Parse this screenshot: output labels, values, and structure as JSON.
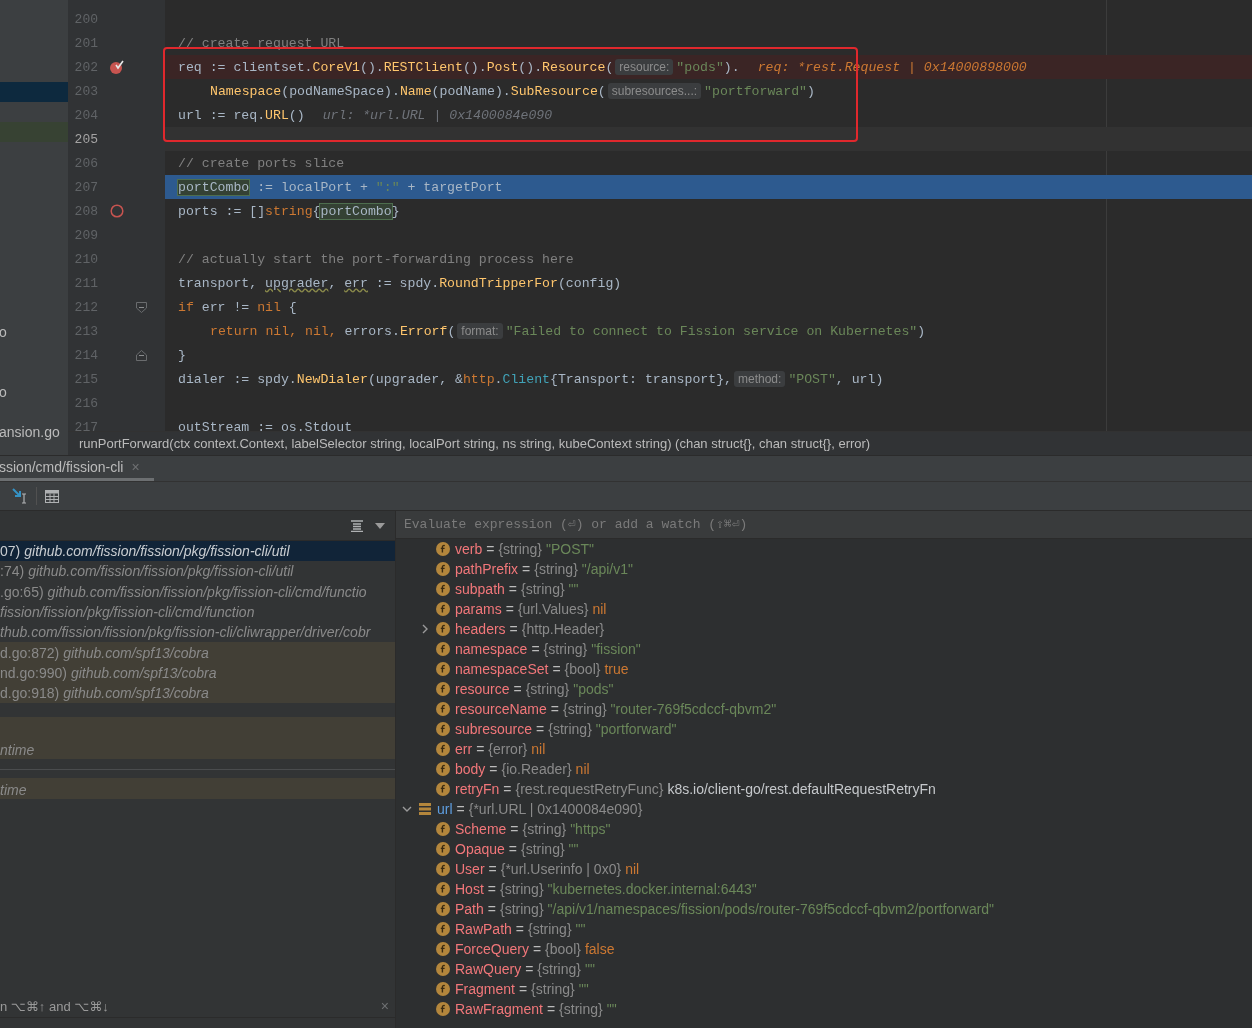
{
  "sidebar": {
    "rows": [
      {
        "kind": "blank"
      },
      {
        "kind": "blank"
      },
      {
        "kind": "blank"
      },
      {
        "kind": "blank"
      },
      {
        "kind": "selected"
      },
      {
        "kind": "blank"
      },
      {
        "kind": "modified"
      },
      {
        "kind": "blank"
      },
      {
        "kind": "blank"
      },
      {
        "kind": "blank"
      },
      {
        "kind": "blank"
      },
      {
        "kind": "blank"
      },
      {
        "kind": "blank"
      },
      {
        "kind": "blank"
      },
      {
        "kind": "blank"
      },
      {
        "kind": "blank"
      },
      {
        "kind": "file",
        "label": "o"
      },
      {
        "kind": "blank"
      },
      {
        "kind": "blank"
      },
      {
        "kind": "file",
        "label": "o"
      },
      {
        "kind": "blank"
      },
      {
        "kind": "file",
        "label": "ansion.go"
      }
    ]
  },
  "editor": {
    "lines": [
      {
        "number": "200",
        "kind": "plain"
      },
      {
        "number": "201",
        "kind": "plain",
        "indented": false,
        "tokens": [
          {
            "kind": "cmt",
            "text": "// create request URL"
          }
        ]
      },
      {
        "number": "202",
        "kind": "suspended",
        "indented": false,
        "tokens": [
          {
            "kind": "p",
            "text": "req := clientset."
          },
          {
            "kind": "fn",
            "text": "CoreV1"
          },
          {
            "kind": "p",
            "text": "()."
          },
          {
            "kind": "fn",
            "text": "RESTClient"
          },
          {
            "kind": "p",
            "text": "()."
          },
          {
            "kind": "fn",
            "text": "Post"
          },
          {
            "kind": "p",
            "text": "()."
          },
          {
            "kind": "fn",
            "text": "Resource"
          },
          {
            "kind": "p",
            "text": "("
          },
          {
            "kind": "hint",
            "text": "resource:"
          },
          {
            "kind": "str",
            "text": "\"pods\""
          },
          {
            "kind": "p",
            "text": ")."
          },
          {
            "kind": "dbg_hit",
            "text": "req: *rest.Request | 0x14000898000"
          }
        ]
      },
      {
        "number": "203",
        "kind": "plain",
        "indented": true,
        "tokens": [
          {
            "kind": "fn",
            "text": "Namespace"
          },
          {
            "kind": "p",
            "text": "(podNameSpace)."
          },
          {
            "kind": "fn",
            "text": "Name"
          },
          {
            "kind": "p",
            "text": "(podName)."
          },
          {
            "kind": "fn",
            "text": "SubResource"
          },
          {
            "kind": "p",
            "text": "("
          },
          {
            "kind": "hint",
            "text": "subresources...:"
          },
          {
            "kind": "str",
            "text": "\"portforward\""
          },
          {
            "kind": "p",
            "text": ")"
          }
        ]
      },
      {
        "number": "204",
        "kind": "plain",
        "indented": false,
        "tokens": [
          {
            "kind": "p",
            "text": "url := req."
          },
          {
            "kind": "fn",
            "text": "URL"
          },
          {
            "kind": "p",
            "text": "()"
          },
          {
            "kind": "dbg",
            "text": "url: *url.URL | 0x1400084e090"
          }
        ]
      },
      {
        "number": "205",
        "kind": "current"
      },
      {
        "number": "206",
        "kind": "plain",
        "indented": false,
        "tokens": [
          {
            "kind": "cmt",
            "text": "// create ports slice"
          }
        ]
      },
      {
        "number": "207",
        "kind": "selected",
        "indented": false,
        "tokens": [
          {
            "kind": "usage",
            "text": "portCombo"
          },
          {
            "kind": "p",
            "text": " := localPort + "
          },
          {
            "kind": "str",
            "text": "\":\""
          },
          {
            "kind": "p",
            "text": " + targetPort"
          }
        ]
      },
      {
        "number": "208",
        "kind": "breakpoint",
        "indented": false,
        "tokens": [
          {
            "kind": "p",
            "text": "ports := []"
          },
          {
            "kind": "kw",
            "text": "string"
          },
          {
            "kind": "p",
            "text": "{"
          },
          {
            "kind": "usage",
            "text": "portCombo"
          },
          {
            "kind": "p",
            "text": "}"
          }
        ]
      },
      {
        "number": "209",
        "kind": "plain"
      },
      {
        "number": "210",
        "kind": "plain",
        "indented": false,
        "tokens": [
          {
            "kind": "cmt",
            "text": "// actually start the port-forwarding process here"
          }
        ]
      },
      {
        "number": "211",
        "kind": "plain",
        "indented": false,
        "tokens": [
          {
            "kind": "p",
            "text": "transport, "
          },
          {
            "kind": "warn",
            "text": "upgrader"
          },
          {
            "kind": "p",
            "text": ", "
          },
          {
            "kind": "warn",
            "text": "err"
          },
          {
            "kind": "p",
            "text": " := spdy."
          },
          {
            "kind": "fn",
            "text": "RoundTripperFor"
          },
          {
            "kind": "p",
            "text": "(config)"
          }
        ]
      },
      {
        "number": "212",
        "kind": "fold_start",
        "indented": false,
        "tokens": [
          {
            "kind": "kw",
            "text": "if"
          },
          {
            "kind": "p",
            "text": " err != "
          },
          {
            "kind": "kw",
            "text": "nil"
          },
          {
            "kind": "p",
            "text": " {"
          }
        ]
      },
      {
        "number": "213",
        "kind": "plain",
        "indented": true,
        "tokens": [
          {
            "kind": "kw",
            "text": "return nil, nil,"
          },
          {
            "kind": "p",
            "text": " errors."
          },
          {
            "kind": "fn",
            "text": "Errorf"
          },
          {
            "kind": "p",
            "text": "("
          },
          {
            "kind": "hint",
            "text": "format:"
          },
          {
            "kind": "str",
            "text": "\"Failed to connect to Fission service on Kubernetes\""
          },
          {
            "kind": "p",
            "text": ")"
          }
        ]
      },
      {
        "number": "214",
        "kind": "fold_end",
        "indented": false,
        "tokens": [
          {
            "kind": "p",
            "text": "}"
          }
        ]
      },
      {
        "number": "215",
        "kind": "plain",
        "indented": false,
        "tokens": [
          {
            "kind": "p",
            "text": "dialer := spdy."
          },
          {
            "kind": "fn",
            "text": "NewDialer"
          },
          {
            "kind": "p",
            "text": "(upgrader, &"
          },
          {
            "kind": "kw",
            "text": "http"
          },
          {
            "kind": "p",
            "text": "."
          },
          {
            "kind": "type",
            "text": "Client"
          },
          {
            "kind": "p",
            "text": "{Transport: transport},"
          },
          {
            "kind": "hint",
            "text": "method:"
          },
          {
            "kind": "str",
            "text": "\"POST\""
          },
          {
            "kind": "p",
            "text": ", url)"
          }
        ]
      },
      {
        "number": "216",
        "kind": "plain"
      },
      {
        "number": "217",
        "kind": "plain",
        "indented": false,
        "tokens": [
          {
            "kind": "p",
            "text": "outStream := os.Stdout"
          }
        ]
      }
    ],
    "breadcrumb": "runPortForward(ctx context.Context, labelSelector string, localPort string, ns string, kubeContext string) (chan struct{}, chan struct{}, error)"
  },
  "debug_tab": {
    "label": "ssion/cmd/fission-cli",
    "close": "×"
  },
  "frames": [
    {
      "lead": "07)",
      "package": "github.com/fission/fission/pkg/fission-cli/util",
      "selected": true,
      "library": false
    },
    {
      "lead": ":74)",
      "package": "github.com/fission/fission/pkg/fission-cli/util",
      "selected": false,
      "library": false
    },
    {
      "lead": ".go:65)",
      "package": "github.com/fission/fission/pkg/fission-cli/cmd/functio",
      "selected": false,
      "library": false
    },
    {
      "package": "fission/fission/pkg/fission-cli/cmd/function",
      "selected": false,
      "library": false
    },
    {
      "package": "thub.com/fission/fission/pkg/fission-cli/cliwrapper/driver/cobr",
      "selected": false,
      "library": false
    },
    {
      "lead": "d.go:872)",
      "package": "github.com/spf13/cobra",
      "selected": false,
      "library": true
    },
    {
      "lead": "nd.go:990)",
      "package": "github.com/spf13/cobra",
      "selected": false,
      "library": true
    },
    {
      "lead": "d.go:918)",
      "package": "github.com/spf13/cobra",
      "selected": false,
      "library": true
    }
  ],
  "threads": [
    {
      "label": "ntime"
    },
    {
      "label": "time"
    }
  ],
  "frames_hint": {
    "text": "n ⌥⌘↑ and ⌥⌘↓",
    "close": "×"
  },
  "watch": {
    "placeholder": "Evaluate expression (⏎) or add a watch (⇧⌘⏎)"
  },
  "variables": [
    {
      "kind": "continuation",
      "children": [
        {
          "kind": "field",
          "name": "verb",
          "op": "=",
          "type": "{string}",
          "value": {
            "kind": "str",
            "text": "\"POST\""
          }
        },
        {
          "kind": "field",
          "name": "pathPrefix",
          "op": "=",
          "type": "{string}",
          "value": {
            "kind": "str",
            "text": "\"/api/v1\""
          }
        },
        {
          "kind": "field",
          "name": "subpath",
          "op": "=",
          "type": "{string}",
          "value": {
            "kind": "str",
            "text": "\"\""
          }
        },
        {
          "kind": "field",
          "name": "params",
          "op": "=",
          "type": "{url.Values}",
          "value": {
            "kind": "kw",
            "text": "nil"
          }
        },
        {
          "kind": "field",
          "name": "headers",
          "op": "=",
          "type": "{http.Header}",
          "expanded": false
        },
        {
          "kind": "field",
          "name": "namespace",
          "op": "=",
          "type": "{string}",
          "value": {
            "kind": "str",
            "text": "\"fission\""
          }
        },
        {
          "kind": "field",
          "name": "namespaceSet",
          "op": "=",
          "type": "{bool}",
          "value": {
            "kind": "kw",
            "text": "true"
          }
        },
        {
          "kind": "field",
          "name": "resource",
          "op": "=",
          "type": "{string}",
          "value": {
            "kind": "str",
            "text": "\"pods\""
          }
        },
        {
          "kind": "field",
          "name": "resourceName",
          "op": "=",
          "type": "{string}",
          "value": {
            "kind": "str",
            "text": "\"router-769f5cdccf-qbvm2\""
          }
        },
        {
          "kind": "field",
          "name": "subresource",
          "op": "=",
          "type": "{string}",
          "value": {
            "kind": "str",
            "text": "\"portforward\""
          }
        },
        {
          "kind": "field",
          "name": "err",
          "op": "=",
          "type": "{error}",
          "value": {
            "kind": "kw",
            "text": "nil"
          }
        },
        {
          "kind": "field",
          "name": "body",
          "op": "=",
          "type": "{io.Reader}",
          "value": {
            "kind": "kw",
            "text": "nil"
          }
        },
        {
          "kind": "field",
          "name": "retryFn",
          "op": "=",
          "type": "{rest.requestRetryFunc}",
          "value": {
            "kind": "plain",
            "text": "k8s.io/client-go/rest.defaultRequestRetryFn"
          }
        }
      ]
    },
    {
      "kind": "struct",
      "name": "url",
      "op": "=",
      "type": "{*url.URL | 0x1400084e090}",
      "expanded": true,
      "children": [
        {
          "kind": "field",
          "name": "Scheme",
          "op": "=",
          "type": "{string}",
          "value": {
            "kind": "str",
            "text": "\"https\""
          }
        },
        {
          "kind": "field",
          "name": "Opaque",
          "op": "=",
          "type": "{string}",
          "value": {
            "kind": "str",
            "text": "\"\""
          }
        },
        {
          "kind": "field",
          "name": "User",
          "op": "=",
          "type": "{*url.Userinfo | 0x0}",
          "value": {
            "kind": "kw",
            "text": "nil"
          }
        },
        {
          "kind": "field",
          "name": "Host",
          "op": "=",
          "type": "{string}",
          "value": {
            "kind": "str",
            "text": "\"kubernetes.docker.internal:6443\""
          }
        },
        {
          "kind": "field",
          "name": "Path",
          "op": "=",
          "type": "{string}",
          "value": {
            "kind": "str",
            "text": "\"/api/v1/namespaces/fission/pods/router-769f5cdccf-qbvm2/portforward\""
          }
        },
        {
          "kind": "field",
          "name": "RawPath",
          "op": "=",
          "type": "{string}",
          "value": {
            "kind": "str",
            "text": "\"\""
          }
        },
        {
          "kind": "field",
          "name": "ForceQuery",
          "op": "=",
          "type": "{bool}",
          "value": {
            "kind": "kw",
            "text": "false"
          }
        },
        {
          "kind": "field",
          "name": "RawQuery",
          "op": "=",
          "type": "{string}",
          "value": {
            "kind": "str",
            "text": "\"\""
          }
        },
        {
          "kind": "field",
          "name": "Fragment",
          "op": "=",
          "type": "{string}",
          "value": {
            "kind": "str",
            "text": "\"\""
          }
        },
        {
          "kind": "field",
          "name": "RawFragment",
          "op": "=",
          "type": "{string}",
          "value": {
            "kind": "str",
            "text": "\"\""
          }
        }
      ]
    }
  ]
}
